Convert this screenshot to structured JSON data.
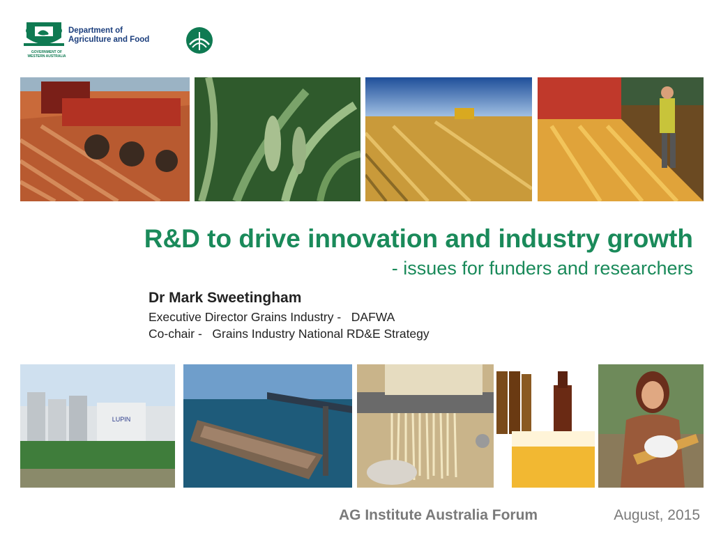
{
  "header": {
    "department_line1": "Department of",
    "department_line2": "Agriculture and Food",
    "government_line1": "GOVERNMENT OF",
    "government_line2": "WESTERN AUSTRALIA"
  },
  "slide": {
    "title": "R&D to drive innovation and industry growth",
    "subtitle": "- issues for funders and researchers",
    "presenter": "Dr Mark Sweetingham",
    "role_1": "Executive Director Grains Industry -   DAFWA",
    "role_2": "Co-chair -   Grains Industry National RD&E Strategy"
  },
  "photos": {
    "top": [
      "tractor-plough-photo",
      "wheat-crop-photo",
      "harvester-field-photo",
      "grain-unloading-photo"
    ],
    "bottom": [
      "grain-processing-plant-photo",
      "grain-ship-port-photo",
      "noodle-making-photo",
      "beer-bottles-photo",
      "woman-with-bread-photo"
    ],
    "plant_sign": "LUPIN"
  },
  "footer": {
    "event": "AG Institute Australia Forum",
    "date": "August, 2015"
  },
  "colors": {
    "title_green": "#1a8a5a",
    "logo_green": "#0f7a52",
    "logo_blue": "#1a3d7c",
    "footer_grey": "#7a7a7a"
  }
}
